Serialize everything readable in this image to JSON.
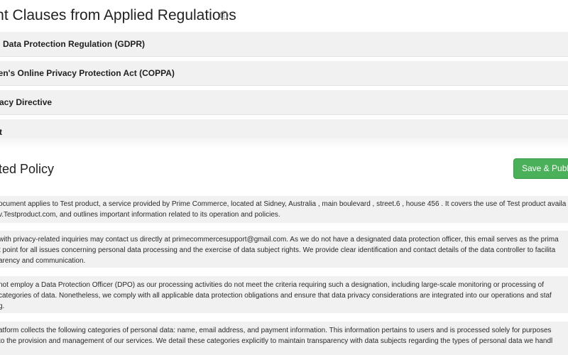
{
  "section": {
    "title": "vant Clauses from Applied Regulations",
    "info_icon": "info-circle-icon"
  },
  "regulations": [
    "ral Data Protection Regulation (GDPR)",
    "ren's Online Privacy Protection Act (COPPA)",
    "acy Directive",
    "t"
  ],
  "policy": {
    "title": "erated Policy",
    "save_button": "Save & Publi",
    "paragraphs": [
      [
        "ocument applies to Test product, a service provided by Prime Commerce, located at Sidney, Australia , main boulevard , street.6 , house 456 . It covers the use of Test product availa",
        "v.Testproduct.com, and outlines important information related to its operation and policies."
      ],
      [
        "with privacy-related inquiries may contact us directly at primecommercesupport@gmail.com. As we do not have a designated data protection officer, this email serves as the prima",
        "t point for all issues concerning personal data processing and the exercise of data subject rights. We provide clear identification and contact details of the data controller to facilita",
        "arency and communication."
      ],
      [
        "not employ a Data Protection Officer (DPO) as our processing activities do not meet the criteria requiring such a designation, including large-scale monitoring or processing of",
        "categories of data. Nonetheless, we comply with all applicable data protection obligations and ensure that data privacy considerations are integrated into our operations and staf",
        "g."
      ],
      [
        "atform collects the following categories of personal data: name, email address, and payment information. This information pertains to users and is processed solely for purposes",
        "to the provision and management of our services. We detail these categories explicitly to maintain transparency with data subjects regarding the types of personal data we handl"
      ]
    ]
  },
  "colors": {
    "accordion_bg": "#f1f1f1",
    "paragraph_bg": "#f1f1f1",
    "save_button_bg": "#4bb05a"
  }
}
